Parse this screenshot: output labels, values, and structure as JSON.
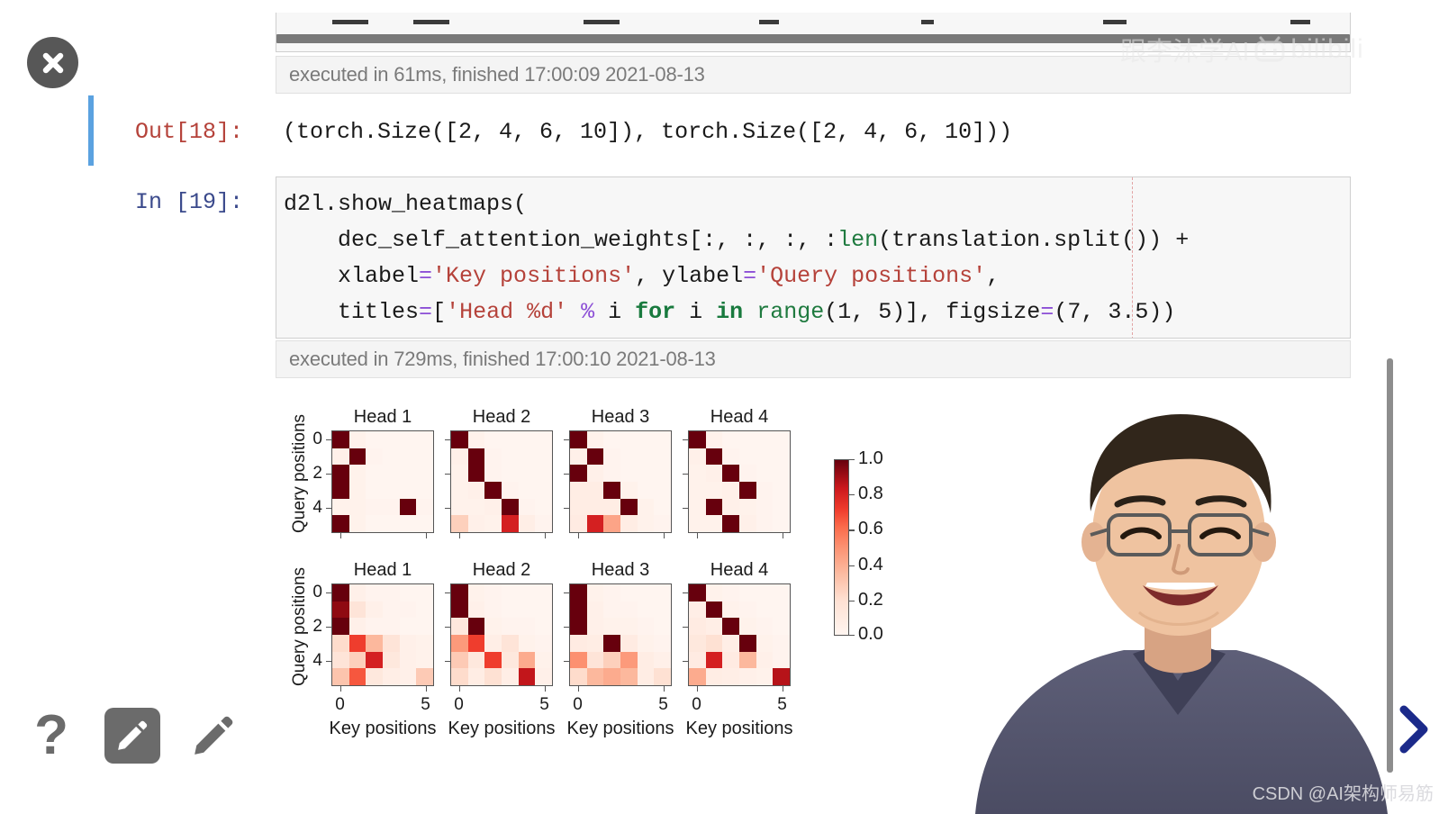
{
  "player": {
    "close_icon": "close-icon",
    "tools": [
      {
        "name": "help-icon",
        "glyph": "?",
        "active": false
      },
      {
        "name": "pen-tool-icon",
        "glyph": "pencil",
        "active": true
      },
      {
        "name": "pencil-tool-icon",
        "glyph": "pencil",
        "active": false
      }
    ],
    "next_arrow_icon": "chevron-right-icon"
  },
  "notebook": {
    "cell_out": {
      "prompt": "Out[18]:",
      "text": "(torch.Size([2, 4, 6, 10]), torch.Size([2, 4, 6, 10]))",
      "exec_status": "executed in 61ms, finished 17:00:09 2021-08-13"
    },
    "cell_in": {
      "prompt": "In [19]:",
      "exec_status": "executed in 729ms, finished 17:00:10 2021-08-13",
      "lines": [
        [
          {
            "t": "d2l.show_heatmaps(",
            "c": "plain"
          }
        ],
        [
          {
            "t": "    dec_self_attention_weights[:, :, :, :",
            "c": "plain"
          },
          {
            "t": "len",
            "c": "fn"
          },
          {
            "t": "(translation.split())",
            "c": "plain"
          },
          {
            "t": " +",
            "c": "plain"
          }
        ],
        [
          {
            "t": "    xlabel",
            "c": "plain"
          },
          {
            "t": "=",
            "c": "op"
          },
          {
            "t": "'Key positions'",
            "c": "str"
          },
          {
            "t": ", ylabel",
            "c": "plain"
          },
          {
            "t": "=",
            "c": "op"
          },
          {
            "t": "'Query positions'",
            "c": "str"
          },
          {
            "t": ",",
            "c": "plain"
          }
        ],
        [
          {
            "t": "    titles",
            "c": "plain"
          },
          {
            "t": "=",
            "c": "op"
          },
          {
            "t": "[",
            "c": "plain"
          },
          {
            "t": "'Head %d'",
            "c": "str"
          },
          {
            "t": " ",
            "c": "plain"
          },
          {
            "t": "%",
            "c": "op"
          },
          {
            "t": " i ",
            "c": "plain"
          },
          {
            "t": "for",
            "c": "kw"
          },
          {
            "t": " i ",
            "c": "plain"
          },
          {
            "t": "in",
            "c": "kw"
          },
          {
            "t": " ",
            "c": "plain"
          },
          {
            "t": "range",
            "c": "fn"
          },
          {
            "t": "(",
            "c": "plain"
          },
          {
            "t": "1",
            "c": "num"
          },
          {
            "t": ", ",
            "c": "plain"
          },
          {
            "t": "5",
            "c": "num"
          },
          {
            "t": ")], figsize",
            "c": "plain"
          },
          {
            "t": "=",
            "c": "op"
          },
          {
            "t": "(",
            "c": "plain"
          },
          {
            "t": "7",
            "c": "num"
          },
          {
            "t": ", ",
            "c": "plain"
          },
          {
            "t": "3.5",
            "c": "num"
          },
          {
            "t": "))",
            "c": "plain"
          }
        ]
      ]
    }
  },
  "chart_data": {
    "type": "heatmap",
    "title": "",
    "xlabel": "Key positions",
    "ylabel": "Query positions",
    "colormap": "Reds",
    "colorbar": {
      "ticks": [
        "1.0",
        "0.8",
        "0.6",
        "0.4",
        "0.2",
        "0.0"
      ],
      "vmin": 0.0,
      "vmax": 1.0
    },
    "xticks": [
      "0",
      "5"
    ],
    "yticks": [
      "0",
      "2",
      "4"
    ],
    "nrows": 2,
    "ncols": 4,
    "cell_rows": 6,
    "cell_cols": 6,
    "panels": [
      {
        "row": 0,
        "col": 0,
        "title": "Head 1",
        "matrix": [
          [
            1.0,
            0.02,
            0.0,
            0.0,
            0.0,
            0.0
          ],
          [
            0.03,
            1.0,
            0.01,
            0.0,
            0.0,
            0.0
          ],
          [
            1.0,
            0.02,
            0.0,
            0.0,
            0.0,
            0.0
          ],
          [
            1.0,
            0.02,
            0.0,
            0.0,
            0.0,
            0.0
          ],
          [
            0.02,
            0.02,
            0.01,
            0.01,
            1.0,
            0.01
          ],
          [
            1.0,
            0.02,
            0.0,
            0.0,
            0.0,
            0.0
          ]
        ]
      },
      {
        "row": 0,
        "col": 1,
        "title": "Head 2",
        "matrix": [
          [
            1.0,
            0.02,
            0.0,
            0.0,
            0.0,
            0.0
          ],
          [
            0.03,
            1.0,
            0.01,
            0.0,
            0.0,
            0.0
          ],
          [
            0.02,
            1.0,
            0.01,
            0.0,
            0.0,
            0.0
          ],
          [
            0.02,
            0.03,
            1.0,
            0.01,
            0.0,
            0.0
          ],
          [
            0.02,
            0.02,
            0.03,
            1.0,
            0.01,
            0.0
          ],
          [
            0.18,
            0.03,
            0.02,
            0.72,
            0.04,
            0.01
          ]
        ]
      },
      {
        "row": 0,
        "col": 2,
        "title": "Head 3",
        "matrix": [
          [
            1.0,
            0.02,
            0.0,
            0.0,
            0.0,
            0.0
          ],
          [
            0.03,
            1.0,
            0.01,
            0.0,
            0.0,
            0.0
          ],
          [
            1.0,
            0.03,
            0.01,
            0.0,
            0.0,
            0.0
          ],
          [
            0.05,
            0.05,
            1.0,
            0.02,
            0.0,
            0.0
          ],
          [
            0.05,
            0.05,
            0.05,
            1.0,
            0.02,
            0.0
          ],
          [
            0.06,
            0.72,
            0.32,
            0.05,
            0.02,
            0.01
          ]
        ]
      },
      {
        "row": 0,
        "col": 3,
        "title": "Head 4",
        "matrix": [
          [
            1.0,
            0.02,
            0.0,
            0.0,
            0.0,
            0.0
          ],
          [
            0.03,
            1.0,
            0.01,
            0.0,
            0.0,
            0.0
          ],
          [
            0.02,
            0.03,
            1.0,
            0.01,
            0.0,
            0.0
          ],
          [
            0.02,
            0.02,
            0.03,
            1.0,
            0.01,
            0.0
          ],
          [
            0.02,
            1.0,
            0.03,
            0.02,
            0.01,
            0.0
          ],
          [
            0.02,
            0.02,
            1.0,
            0.03,
            0.01,
            0.0
          ]
        ]
      },
      {
        "row": 1,
        "col": 0,
        "title": "Head 1",
        "matrix": [
          [
            1.0,
            0.03,
            0.01,
            0.01,
            0.0,
            0.0
          ],
          [
            0.92,
            0.1,
            0.03,
            0.01,
            0.01,
            0.0
          ],
          [
            1.0,
            0.03,
            0.01,
            0.01,
            0.0,
            0.0
          ],
          [
            0.14,
            0.62,
            0.26,
            0.1,
            0.03,
            0.02
          ],
          [
            0.1,
            0.18,
            0.72,
            0.08,
            0.03,
            0.02
          ],
          [
            0.22,
            0.55,
            0.08,
            0.04,
            0.03,
            0.2
          ]
        ]
      },
      {
        "row": 1,
        "col": 1,
        "title": "Head 2",
        "matrix": [
          [
            1.0,
            0.02,
            0.01,
            0.0,
            0.0,
            0.0
          ],
          [
            1.0,
            0.03,
            0.01,
            0.0,
            0.0,
            0.0
          ],
          [
            0.08,
            1.0,
            0.02,
            0.01,
            0.01,
            0.0
          ],
          [
            0.35,
            0.62,
            0.04,
            0.1,
            0.02,
            0.01
          ],
          [
            0.2,
            0.08,
            0.62,
            0.08,
            0.3,
            0.02
          ],
          [
            0.14,
            0.05,
            0.12,
            0.04,
            0.78,
            0.03
          ]
        ]
      },
      {
        "row": 1,
        "col": 2,
        "title": "Head 3",
        "matrix": [
          [
            1.0,
            0.02,
            0.01,
            0.0,
            0.0,
            0.0
          ],
          [
            1.0,
            0.03,
            0.01,
            0.01,
            0.0,
            0.0
          ],
          [
            1.0,
            0.03,
            0.02,
            0.02,
            0.01,
            0.0
          ],
          [
            0.06,
            0.05,
            1.0,
            0.06,
            0.02,
            0.01
          ],
          [
            0.38,
            0.1,
            0.18,
            0.35,
            0.05,
            0.03
          ],
          [
            0.14,
            0.26,
            0.3,
            0.26,
            0.05,
            0.12
          ]
        ]
      },
      {
        "row": 1,
        "col": 3,
        "title": "Head 4",
        "matrix": [
          [
            1.0,
            0.02,
            0.01,
            0.0,
            0.0,
            0.0
          ],
          [
            0.04,
            1.0,
            0.02,
            0.01,
            0.0,
            0.0
          ],
          [
            0.06,
            0.04,
            1.0,
            0.02,
            0.01,
            0.0
          ],
          [
            0.08,
            0.12,
            0.04,
            1.0,
            0.02,
            0.01
          ],
          [
            0.06,
            0.72,
            0.06,
            0.26,
            0.03,
            0.01
          ],
          [
            0.3,
            0.05,
            0.04,
            0.03,
            0.02,
            0.82
          ]
        ]
      }
    ]
  },
  "watermarks": {
    "bilibili": "跟李沐学AI",
    "bilibili_brand": "bilibili",
    "csdn": "CSDN @AI架构师易筋"
  }
}
